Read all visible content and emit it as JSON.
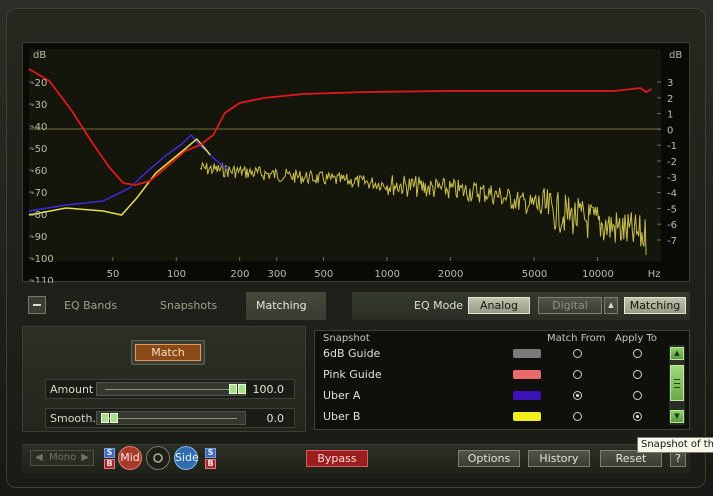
{
  "graph": {
    "left_unit": "dB",
    "right_unit": "dB",
    "left_ticks": [
      "-20",
      "-30",
      "-40",
      "-50",
      "-60",
      "-70",
      "-80",
      "-90",
      "-100",
      "-110"
    ],
    "right_ticks": [
      "3",
      "2",
      "1",
      "0",
      "-1",
      "-2",
      "-3",
      "-4",
      "-5",
      "-6",
      "-7"
    ],
    "freq_ticks": [
      "50",
      "100",
      "200",
      "300",
      "500",
      "1000",
      "2000",
      "5000",
      "10000",
      "Hz"
    ],
    "colors": {
      "match_curve": "#e01a1a",
      "uber_a": "#3b2bd6",
      "uber_b": "#e7df51",
      "spectrum": "#c9bf4e",
      "zero_line": "#6f6d3a"
    }
  },
  "tabs": {
    "eq_bands": "EQ Bands",
    "snapshots": "Snapshots",
    "matching": "Matching"
  },
  "eq_mode": {
    "label": "EQ Mode",
    "analog": "Analog",
    "digital": "Digital",
    "matching": "Matching"
  },
  "match_panel": {
    "match_button": "Match",
    "amount_label": "Amount",
    "amount_value": "100.0",
    "amount_level": 1.0,
    "smooth_label": "Smooth.",
    "smooth_value": "0.0",
    "smooth_level": 0.0
  },
  "snapshot_list": {
    "headers": {
      "snapshot": "Snapshot",
      "match_from": "Match From",
      "apply_to": "Apply To"
    },
    "rows": [
      {
        "name": "6dB Guide",
        "color": "#7a7a7a",
        "match_from": false,
        "apply_to": false
      },
      {
        "name": "Pink Guide",
        "color": "#e86a6a",
        "match_from": false,
        "apply_to": false
      },
      {
        "name": "Uber A",
        "color": "#3b12b8",
        "match_from": true,
        "apply_to": false
      },
      {
        "name": "Uber B",
        "color": "#f2ef1a",
        "match_from": false,
        "apply_to": true
      }
    ]
  },
  "bottom_bar": {
    "mono": "Mono",
    "s": "S",
    "b": "B",
    "mid": "Mid",
    "side": "Side",
    "bypass": "Bypass",
    "options": "Options",
    "history": "History",
    "reset": "Reset",
    "help": "?"
  },
  "tooltip": "Snapshot of th"
}
